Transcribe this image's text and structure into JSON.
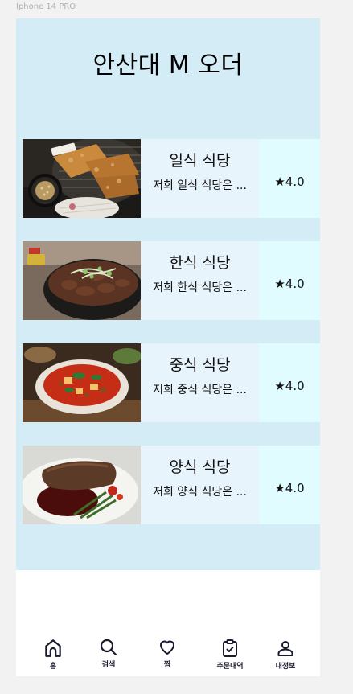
{
  "frame": {
    "label": "Iphone 14 PRO"
  },
  "header": {
    "title": "안산대 M 오더"
  },
  "restaurants": [
    {
      "name": "일식 식당",
      "description": "저희 일식 식당은 ...",
      "rating": "★4.0",
      "image_icon": "tonkatsu-photo"
    },
    {
      "name": "한식 식당",
      "description": "저희 한식 식당은 ...",
      "rating": "★4.0",
      "image_icon": "bulgogi-bowl-photo"
    },
    {
      "name": "중식 식당",
      "description": "저희 중식 식당은 ...",
      "rating": "★4.0",
      "image_icon": "mapo-tofu-photo"
    },
    {
      "name": "양식 식당",
      "description": "저희 양식 식당은 ...",
      "rating": "★4.0",
      "image_icon": "steak-plate-photo"
    }
  ],
  "tabbar": {
    "items": [
      {
        "label": "홈",
        "icon": "home-icon"
      },
      {
        "label": "검색",
        "icon": "search-icon"
      },
      {
        "label": "찜",
        "icon": "heart-icon"
      },
      {
        "label": "주문내역",
        "icon": "clipboard-check-icon"
      },
      {
        "label": "내정보",
        "icon": "user-icon"
      }
    ]
  },
  "colors": {
    "background": "#d3ecf6",
    "info_box": "#e8f4fb",
    "rating_box": "#e0fcff",
    "icon_color": "#1a1a2e"
  }
}
